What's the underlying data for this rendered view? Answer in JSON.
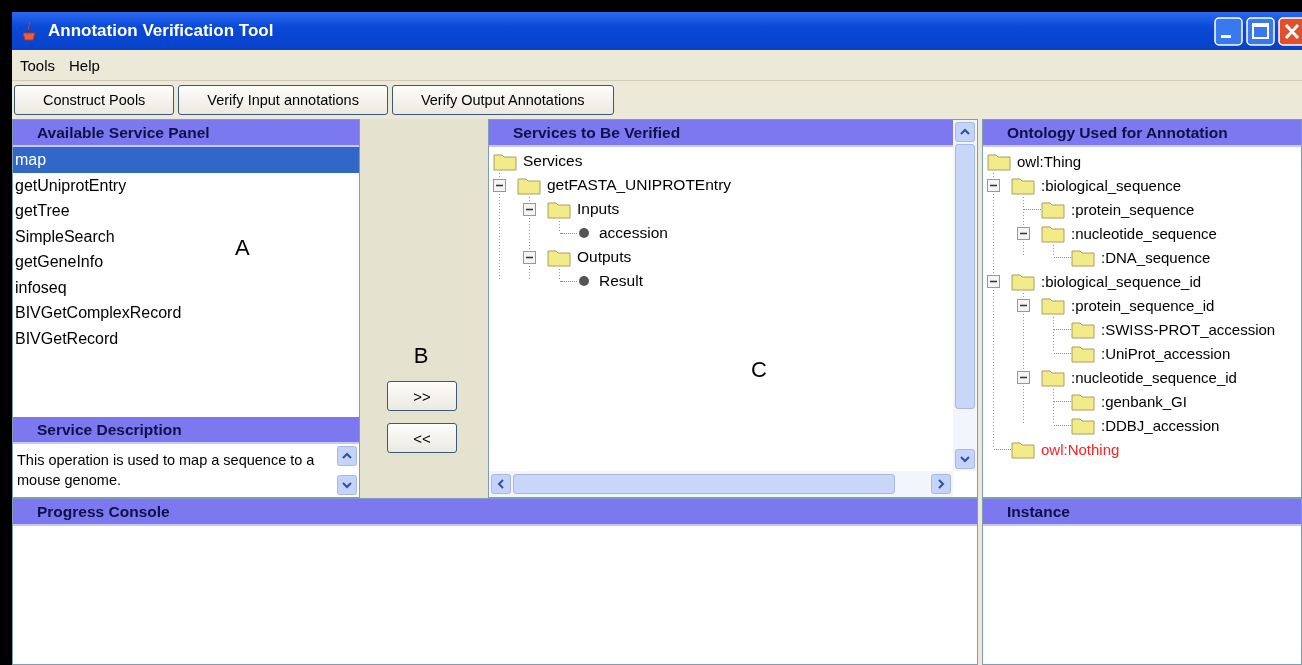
{
  "window": {
    "title": "Annotation Verification Tool"
  },
  "menu": [
    {
      "label": "Tools"
    },
    {
      "label": "Help"
    }
  ],
  "toolbar": [
    {
      "label": "Construct Pools"
    },
    {
      "label": "Verify Input annotations"
    },
    {
      "label": "Verify Output Annotations"
    }
  ],
  "available_service_panel": {
    "title": "Available Service Panel",
    "annotation": "A",
    "items": [
      {
        "label": "map",
        "selected": true
      },
      {
        "label": "getUniprotEntry",
        "selected": false
      },
      {
        "label": "getTree",
        "selected": false
      },
      {
        "label": "SimpleSearch",
        "selected": false
      },
      {
        "label": "getGeneInfo",
        "selected": false
      },
      {
        "label": "infoseq",
        "selected": false
      },
      {
        "label": "BIVGetComplexRecord",
        "selected": false
      },
      {
        "label": "BIVGetRecord",
        "selected": false
      }
    ]
  },
  "service_description": {
    "title": "Service Description",
    "text": "This operation is used to map a sequence to a mouse genome."
  },
  "transfer": {
    "annotation": "B",
    "buttons": [
      {
        "label": ">>"
      },
      {
        "label": "<<"
      }
    ]
  },
  "services_panel": {
    "title": "Services to Be Verified",
    "annotation": "C",
    "tree": {
      "label": "Services",
      "kind": "folder",
      "children": [
        {
          "label": "getFASTA_UNIPROTEntry",
          "kind": "folder",
          "expanded": true,
          "children": [
            {
              "label": "Inputs",
              "kind": "folder",
              "expanded": true,
              "children": [
                {
                  "label": "accession",
                  "kind": "leaf"
                }
              ]
            },
            {
              "label": "Outputs",
              "kind": "folder",
              "expanded": true,
              "children": [
                {
                  "label": "Result",
                  "kind": "leaf"
                }
              ]
            }
          ]
        }
      ]
    }
  },
  "ontology_panel": {
    "title": "Ontology Used for Annotation",
    "tree": {
      "label": "owl:Thing",
      "kind": "folder",
      "color": "#000000",
      "children": [
        {
          "label": ":biological_sequence",
          "kind": "folder",
          "color": "#000000",
          "expanded": true,
          "children": [
            {
              "label": ":protein_sequence",
              "kind": "folder",
              "color": "#000000"
            },
            {
              "label": ":nucleotide_sequence",
              "kind": "folder",
              "color": "#000000",
              "expanded": true,
              "children": [
                {
                  "label": ":DNA_sequence",
                  "kind": "folder",
                  "color": "#000000"
                }
              ]
            }
          ]
        },
        {
          "label": ":biological_sequence_id",
          "kind": "folder",
          "color": "#000000",
          "expanded": true,
          "children": [
            {
              "label": ":protein_sequence_id",
              "kind": "folder",
              "color": "#000000",
              "expanded": true,
              "children": [
                {
                  "label": ":SWISS-PROT_accession",
                  "kind": "folder",
                  "color": "#000000"
                },
                {
                  "label": ":UniProt_accession",
                  "kind": "folder",
                  "color": "#000000"
                }
              ]
            },
            {
              "label": ":nucleotide_sequence_id",
              "kind": "folder",
              "color": "#000000",
              "expanded": true,
              "children": [
                {
                  "label": ":genbank_GI",
                  "kind": "folder",
                  "color": "#000000"
                },
                {
                  "label": ":DDBJ_accession",
                  "kind": "folder",
                  "color": "#000000"
                }
              ]
            }
          ]
        },
        {
          "label": "owl:Nothing",
          "kind": "folder",
          "color": "#ff2020"
        }
      ]
    }
  },
  "progress_console": {
    "title": "Progress Console"
  },
  "instance_panel": {
    "title": "Instance"
  }
}
